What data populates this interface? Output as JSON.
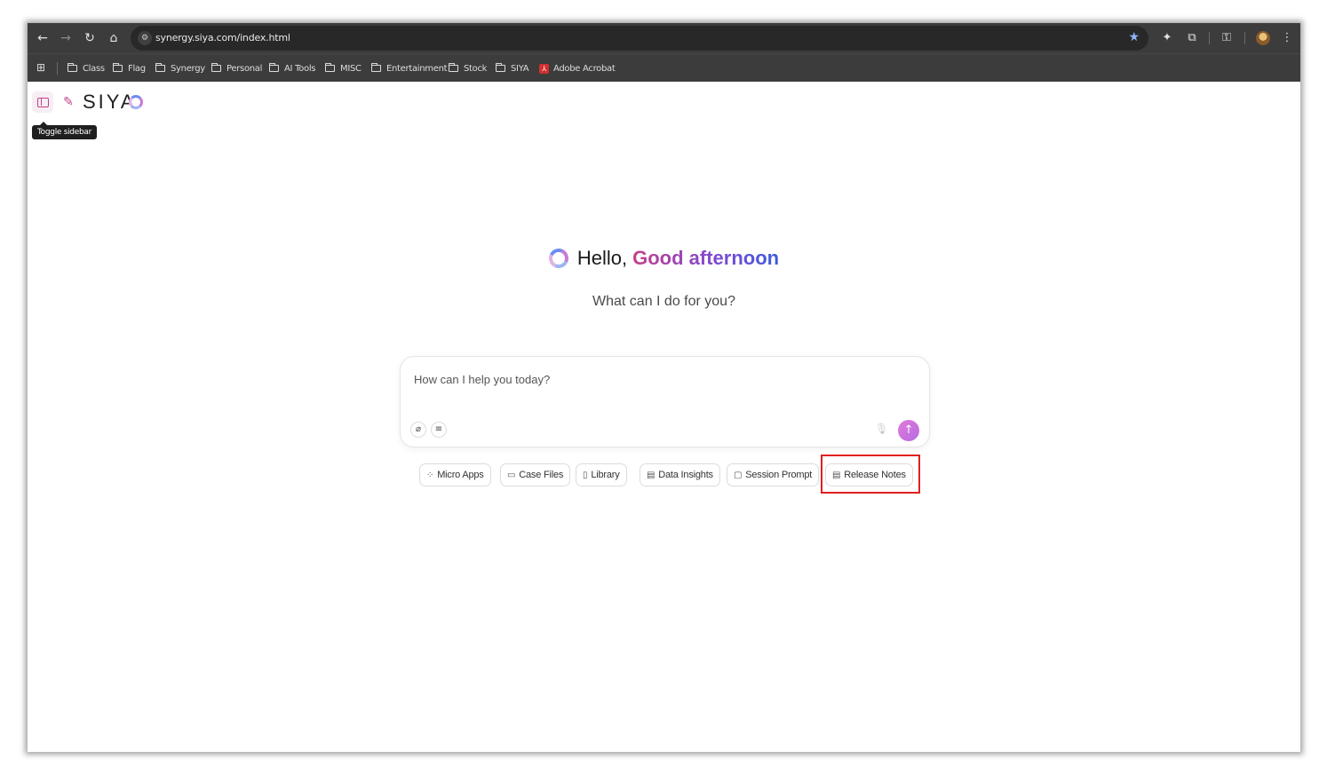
{
  "browser": {
    "url": "synergy.siya.com/index.html",
    "nav_icons": [
      "back-icon",
      "forward-icon",
      "reload-icon",
      "home-icon"
    ],
    "bookmarks": [
      {
        "label": "Class",
        "icon": "folder-icon"
      },
      {
        "label": "Flag",
        "icon": "folder-icon"
      },
      {
        "label": "Synergy",
        "icon": "folder-icon"
      },
      {
        "label": "Personal",
        "icon": "folder-icon"
      },
      {
        "label": "AI Tools",
        "icon": "folder-icon"
      },
      {
        "label": "MISC",
        "icon": "folder-icon"
      },
      {
        "label": "Entertainment",
        "icon": "folder-icon"
      },
      {
        "label": "Stock",
        "icon": "folder-icon"
      },
      {
        "label": "SIYA",
        "icon": "folder-icon"
      },
      {
        "label": "Adobe Acrobat",
        "icon": "pdf-icon"
      }
    ]
  },
  "app": {
    "logo_text": "SIYA",
    "tooltip": "Toggle sidebar",
    "accent_color": "#c2418a",
    "greeting": {
      "hello": "Hello,",
      "time_of_day": "Good afternoon",
      "subtitle": "What can I do for you?"
    },
    "input": {
      "placeholder": "How can I help you today?"
    },
    "chips": [
      {
        "label": "Micro Apps",
        "icon": "grid-icon"
      },
      {
        "label": "Case Files",
        "icon": "folder-icon"
      },
      {
        "label": "Library",
        "icon": "document-icon"
      },
      {
        "label": "Data Insights",
        "icon": "chart-card-icon"
      },
      {
        "label": "Session Prompt",
        "icon": "message-icon"
      },
      {
        "label": "Release Notes",
        "icon": "file-text-icon"
      }
    ],
    "highlighted_chip": "Release Notes"
  }
}
